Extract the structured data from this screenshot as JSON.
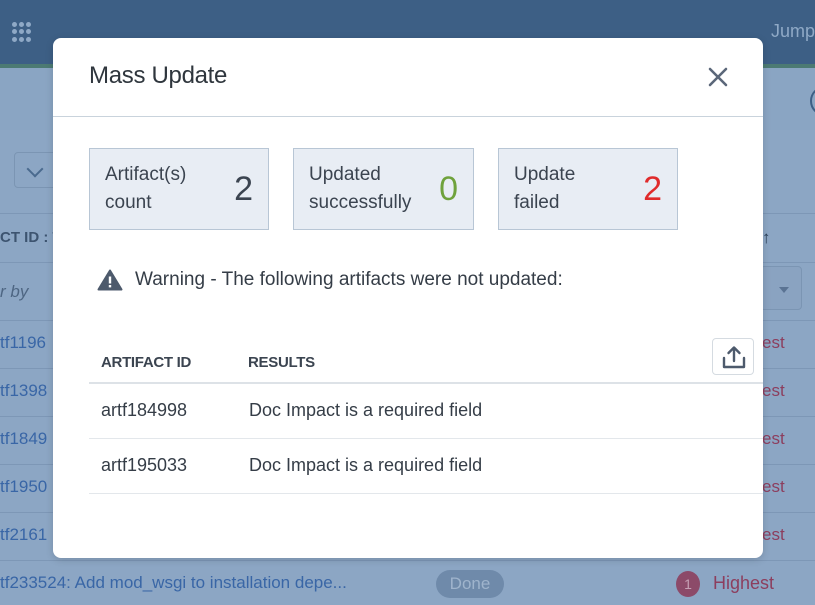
{
  "background": {
    "topbar": {
      "jump_label": "Jump"
    },
    "table": {
      "column_header": "CT ID : T",
      "filter_placeholder": "r by",
      "rows": [
        {
          "id_fragment": "tf1196",
          "priority_fragment": "est"
        },
        {
          "id_fragment": "tf1398",
          "priority_fragment": "est"
        },
        {
          "id_fragment": "tf1849",
          "priority_fragment": "est"
        },
        {
          "id_fragment": "tf1950",
          "priority_fragment": "est"
        },
        {
          "id_fragment": "tf2161",
          "priority_fragment": "est"
        }
      ],
      "last_row": {
        "title": "tf233524: Add mod_wsgi to installation depe...",
        "status": "Done",
        "priority_number": "1",
        "priority": "Highest"
      }
    }
  },
  "modal": {
    "title": "Mass Update",
    "close_icon": "close-icon",
    "stats": [
      {
        "label": "Artifact(s)\ncount",
        "value": "2",
        "color": "#3b4450"
      },
      {
        "label": "Updated\nsuccessfully",
        "value": "0",
        "color": "#6fa23c"
      },
      {
        "label": "Update\nfailed",
        "value": "2",
        "color": "#e02b2b"
      }
    ],
    "warning": {
      "icon": "warning-icon",
      "text": "Warning - The following artifacts were not updated:"
    },
    "table": {
      "export_icon": "export-icon",
      "columns": [
        "ARTIFACT ID",
        "RESULTS"
      ],
      "rows": [
        {
          "id": "artf184998",
          "result": "Doc Impact is a required field"
        },
        {
          "id": "artf195033",
          "result": "Doc Impact is a required field"
        }
      ]
    }
  }
}
